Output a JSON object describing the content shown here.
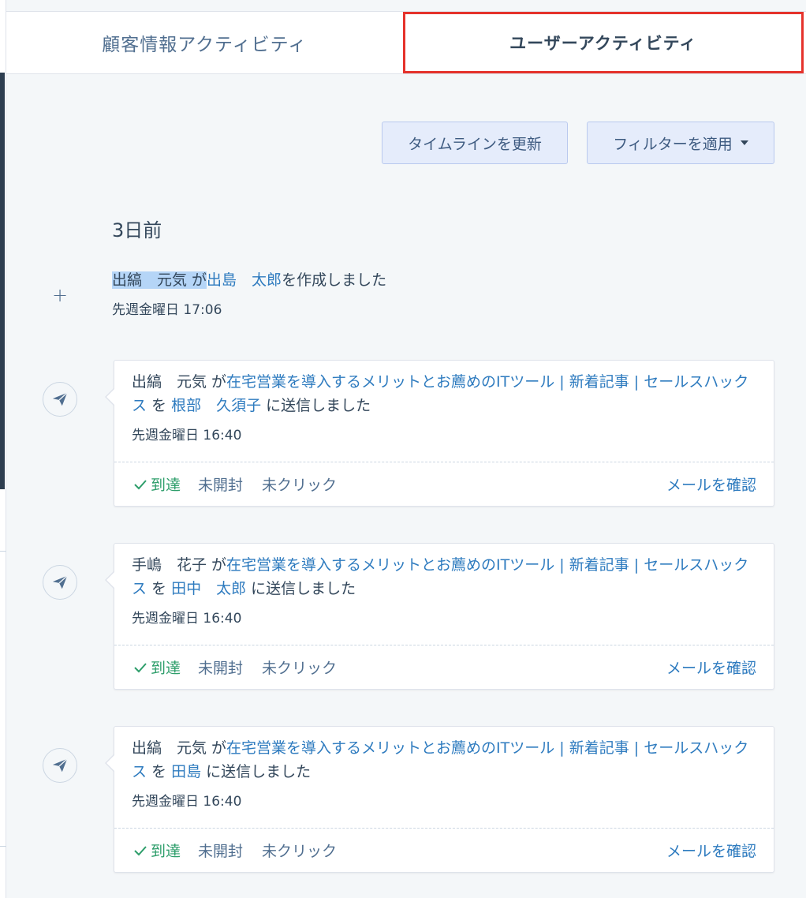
{
  "tabs": [
    {
      "label": "顧客情報アクティビティ",
      "active": false
    },
    {
      "label": "ユーザーアクティビティ",
      "active": true
    }
  ],
  "toolbar": {
    "refresh_label": "タイムラインを更新",
    "filter_label": "フィルターを適用"
  },
  "timeline": {
    "day_header": "3日前",
    "created": {
      "actor": "出縞　元気 が",
      "target": "出島　太郎",
      "action": "を作成しました",
      "time": "先週金曜日 17:06"
    },
    "emails": [
      {
        "sender": "出縞　元気 が",
        "subject": "在宅営業を導入するメリットとお薦めのITツール | 新着記事 | セールスハックス",
        "particle": " を ",
        "recipient": "根部　久須子",
        "suffix": " に送信しました",
        "time": "先週金曜日 16:40",
        "status_delivered": "到達",
        "status_opened": "未開封",
        "status_clicked": "未クリック",
        "view_label": "メールを確認"
      },
      {
        "sender": "手嶋　花子 が",
        "subject": "在宅営業を導入するメリットとお薦めのITツール | 新着記事 | セールスハックス",
        "particle": " を ",
        "recipient": "田中　太郎",
        "suffix": " に送信しました",
        "time": "先週金曜日 16:40",
        "status_delivered": "到達",
        "status_opened": "未開封",
        "status_clicked": "未クリック",
        "view_label": "メールを確認"
      },
      {
        "sender": "出縞　元気 が",
        "subject": "在宅営業を導入するメリットとお薦めのITツール | 新着記事 | セールスハックス",
        "particle": " を ",
        "recipient": "田島",
        "suffix": " に送信しました",
        "time": "先週金曜日 16:40",
        "status_delivered": "到達",
        "status_opened": "未開封",
        "status_clicked": "未クリック",
        "view_label": "メールを確認"
      }
    ]
  },
  "colors": {
    "accent_link": "#2e7bbf",
    "delivered": "#2e9e6b",
    "active_tab_outline": "#e5322b"
  }
}
